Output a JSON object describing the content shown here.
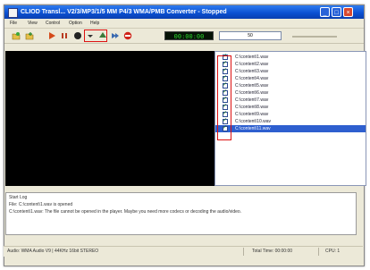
{
  "window": {
    "title": "CLIOD Transl... V2/3/MP3/1/5 MM P4/3 WMA/PMB Converter - Stopped"
  },
  "menu": [
    "File",
    "View",
    "Control",
    "Option",
    "Help"
  ],
  "toolbar": {
    "time_display": "00:00:00",
    "combo_value": "50"
  },
  "files": [
    "C:\\content\\1.wav",
    "C:\\content\\2.wav",
    "C:\\content\\3.wav",
    "C:\\content\\4.wav",
    "C:\\content\\5.wav",
    "C:\\content\\6.wav",
    "C:\\content\\7.wav",
    "C:\\content\\8.wav",
    "C:\\content\\9.wav",
    "C:\\content\\10.wav",
    "C:\\content\\11.wav"
  ],
  "log": [
    "Start Log",
    "File: C:\\content\\1.wav is opened",
    "C:\\content\\1.wav: The file cannot be opened in the player. Maybe you need more codecs or decoding the audio/video."
  ],
  "status": {
    "info": "Audio: WMA Audio V9 | 44KHz 16bit STEREO",
    "total_time": "Total Time: 00:00:00",
    "cpu": "CPU: 1"
  }
}
